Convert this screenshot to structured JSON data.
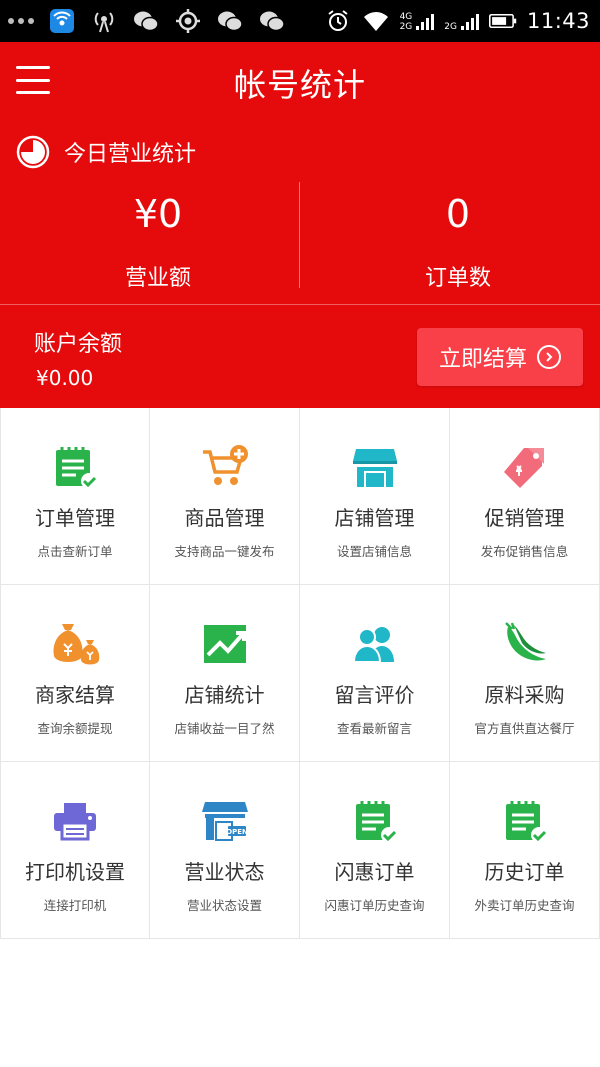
{
  "status_bar": {
    "time": "11:43",
    "network_labels": [
      "4G",
      "2G",
      "2G"
    ]
  },
  "header": {
    "title": "帐号统计",
    "today_label": "今日营业统计",
    "revenue_value": "¥0",
    "revenue_label": "营业额",
    "orders_value": "0",
    "orders_label": "订单数",
    "balance_label": "账户余额",
    "balance_value": "¥0.00",
    "settle_button": "立即结算"
  },
  "colors": {
    "brand_red": "#e50b0c",
    "settle_button": "#f94048",
    "icon_green": "#2ab34a",
    "icon_orange": "#f0912e",
    "icon_teal": "#20b7c9",
    "icon_pink": "#f26b7a",
    "icon_purple": "#6e67d6",
    "icon_blue": "#2f86c7"
  },
  "grid": [
    {
      "title": "订单管理",
      "subtitle": "点击查新订单",
      "icon": "order-list-icon"
    },
    {
      "title": "商品管理",
      "subtitle": "支持商品一键发布",
      "icon": "cart-add-icon"
    },
    {
      "title": "店铺管理",
      "subtitle": "设置店铺信息",
      "icon": "storefront-icon"
    },
    {
      "title": "促销管理",
      "subtitle": "发布促销售信息",
      "icon": "price-tag-icon"
    },
    {
      "title": "商家结算",
      "subtitle": "查询余额提现",
      "icon": "money-bag-icon"
    },
    {
      "title": "店铺统计",
      "subtitle": "店铺收益一目了然",
      "icon": "trend-chart-icon"
    },
    {
      "title": "留言评价",
      "subtitle": "查看最新留言",
      "icon": "users-icon"
    },
    {
      "title": "原料采购",
      "subtitle": "官方直供直达餐厅",
      "icon": "chili-pepper-icon"
    },
    {
      "title": "打印机设置",
      "subtitle": "连接打印机",
      "icon": "printer-icon"
    },
    {
      "title": "营业状态",
      "subtitle": "营业状态设置",
      "icon": "open-shop-icon",
      "icon_text": "OPEN"
    },
    {
      "title": "闪惠订单",
      "subtitle": "闪惠订单历史查询",
      "icon": "order-list-icon"
    },
    {
      "title": "历史订单",
      "subtitle": "外卖订单历史查询",
      "icon": "order-list-icon"
    }
  ]
}
